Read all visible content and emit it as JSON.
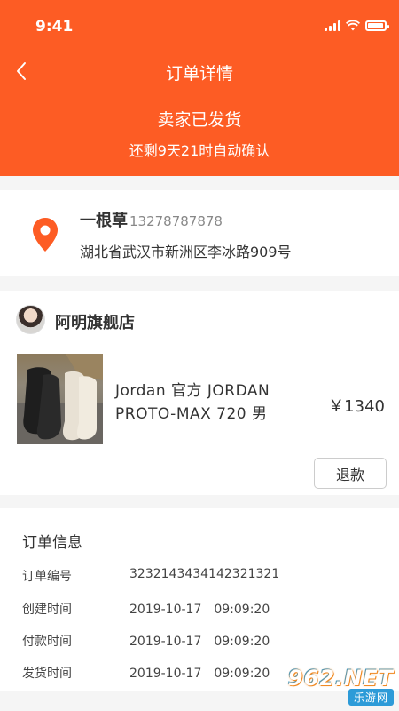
{
  "status_bar": {
    "time": "9:41"
  },
  "header": {
    "title": "订单详情",
    "order_status": "卖家已发货",
    "auto_confirm_text": "还剩9天21时自动确认",
    "background_color": "#fd5c24"
  },
  "address": {
    "receiver_name": "一根草",
    "phone": "13278787878",
    "address_line": "湖北省武汉市新洲区李冰路909号",
    "icon": "location-pin-icon"
  },
  "store": {
    "name": "阿明旗舰店",
    "product": {
      "name": "Jordan 官方 JORDAN PROTO-MAX 720 男",
      "price": "￥1340"
    },
    "refund_label": "退款"
  },
  "order_info": {
    "title": "订单信息",
    "rows": [
      {
        "label": "订单编号",
        "value": "3232143434142321321"
      },
      {
        "label": "创建时间",
        "value": "2019-10-17　09:09:20"
      },
      {
        "label": "付款时间",
        "value": "2019-10-17　09:09:20"
      },
      {
        "label": "发货时间",
        "value": "2019-10-17　09:09:20"
      }
    ]
  },
  "watermark": {
    "main": "962.NET",
    "sub": "乐游网"
  }
}
